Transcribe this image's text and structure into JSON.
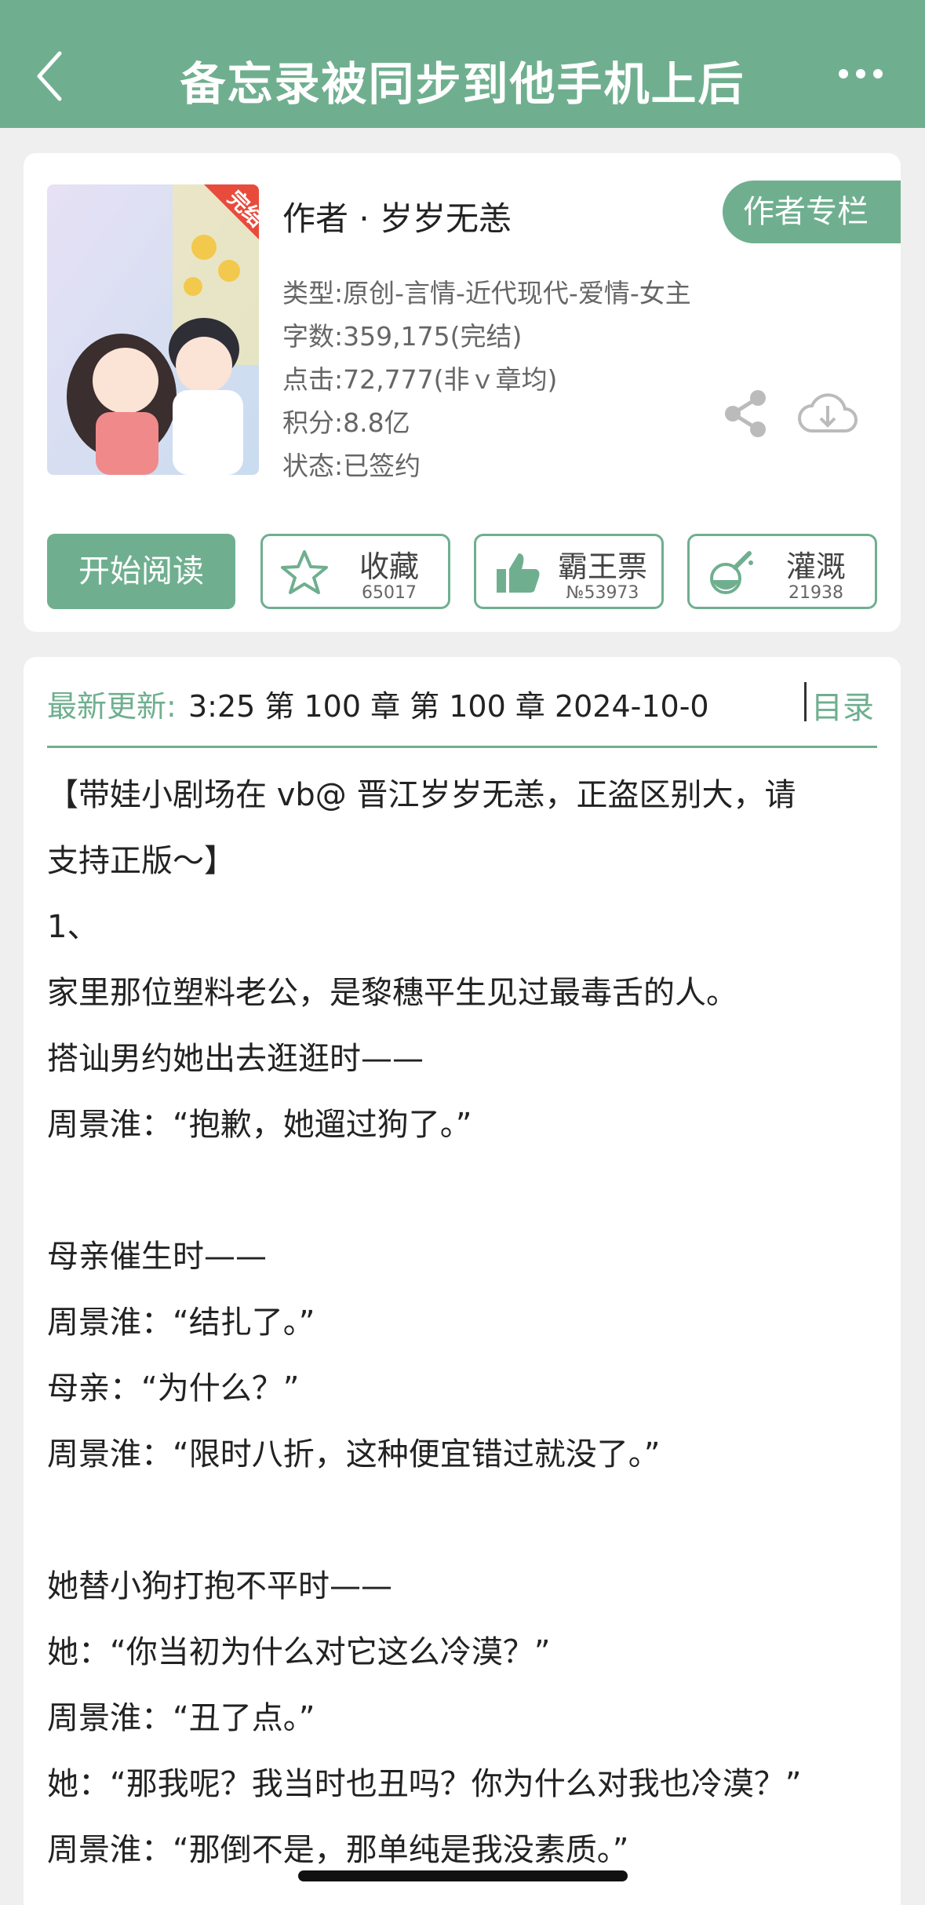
{
  "header": {
    "title": "备忘录被同步到他手机上后",
    "colors": {
      "accent": "#6faf8f"
    }
  },
  "book": {
    "cover_badge": "完结",
    "cover_title": "备忘录被同步到他手机上后",
    "author": "作者 · 岁岁无恙",
    "author_column_button": "作者专栏",
    "type": "类型:原创-言情-近代现代-爱情-女主",
    "word_count": "字数:359,175(完结)",
    "clicks": "点击:72,777(非ｖ章均)",
    "points": "积分:8.8亿",
    "status": "状态:已签约",
    "actions": {
      "read": "开始阅读",
      "favorite": {
        "label": "收藏",
        "count": "65017",
        "icon": "star-icon"
      },
      "vote": {
        "label": "霸王票",
        "count": "№53973",
        "icon": "thumbs-up-icon"
      },
      "water": {
        "label": "灌溉",
        "count": "21938",
        "icon": "flask-icon"
      }
    },
    "icons": [
      "share-icon",
      "cloud-download-icon"
    ]
  },
  "content": {
    "latest_label": "最新更新:",
    "latest_text": "3:25   第 100 章 第 100 章 2024-10-0",
    "toc": "目录",
    "paragraphs": [
      "【带娃小剧场在 vb@ 晋江岁岁无恙，正盗区别大，请",
      "支持正版～】",
      "1、",
      "家里那位塑料老公，是黎穗平生见过最毒舌的人。",
      "搭讪男约她出去逛逛时——",
      "周景淮：“抱歉，她遛过狗了。”",
      "",
      "母亲催生时——",
      "周景淮：“结扎了。”",
      "母亲：“为什么？”",
      "周景淮：“限时八折，这种便宜错过就没了。”",
      "",
      "她替小狗打抱不平时——",
      "她：“你当初为什么对它这么冷漠？”",
      "周景淮：“丑了点。”",
      "她：“那我呢？我当时也丑吗？你为什么对我也冷漠？”",
      "周景淮：“那倒不是，那单纯是我没素质。”"
    ]
  }
}
